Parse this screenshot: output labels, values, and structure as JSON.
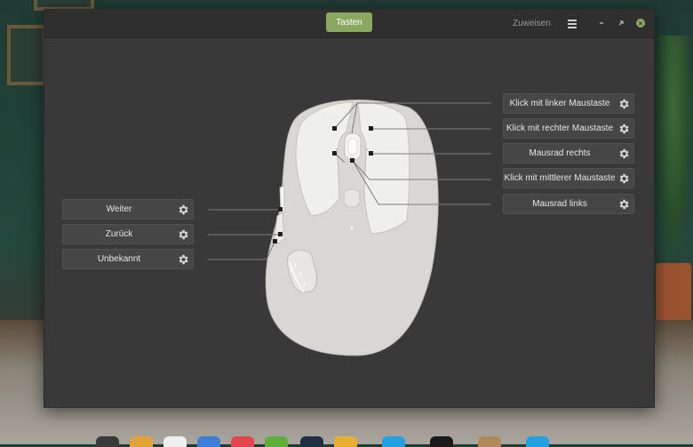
{
  "window": {
    "tabs": {
      "active": "Tasten",
      "inactive": "Zuweisen"
    }
  },
  "buttons": {
    "right": [
      {
        "label": "Klick mit linker Maustaste"
      },
      {
        "label": "Klick mit rechter Maustaste"
      },
      {
        "label": "Mausrad rechts"
      },
      {
        "label": "Klick mit mittlerer Maustaste"
      },
      {
        "label": "Mausrad links"
      }
    ],
    "left": [
      {
        "label": "Weiter"
      },
      {
        "label": "Zurück"
      },
      {
        "label": "Unbekannt"
      }
    ]
  },
  "mouse": {
    "thumb_buttons": [
      "1",
      "2",
      "3"
    ]
  },
  "colors": {
    "accent": "#8aa860",
    "window_bg": "#393939",
    "button_bg": "#464646",
    "mouse_body": "#d9d7d3",
    "mouse_buttons": "#efefee",
    "text": "#e6e6e6"
  },
  "icons": {
    "settings": "gear-icon",
    "menu": "hamburger-icon",
    "minimize": "minimize-icon",
    "maximize": "maximize-icon",
    "close": "close-icon"
  }
}
